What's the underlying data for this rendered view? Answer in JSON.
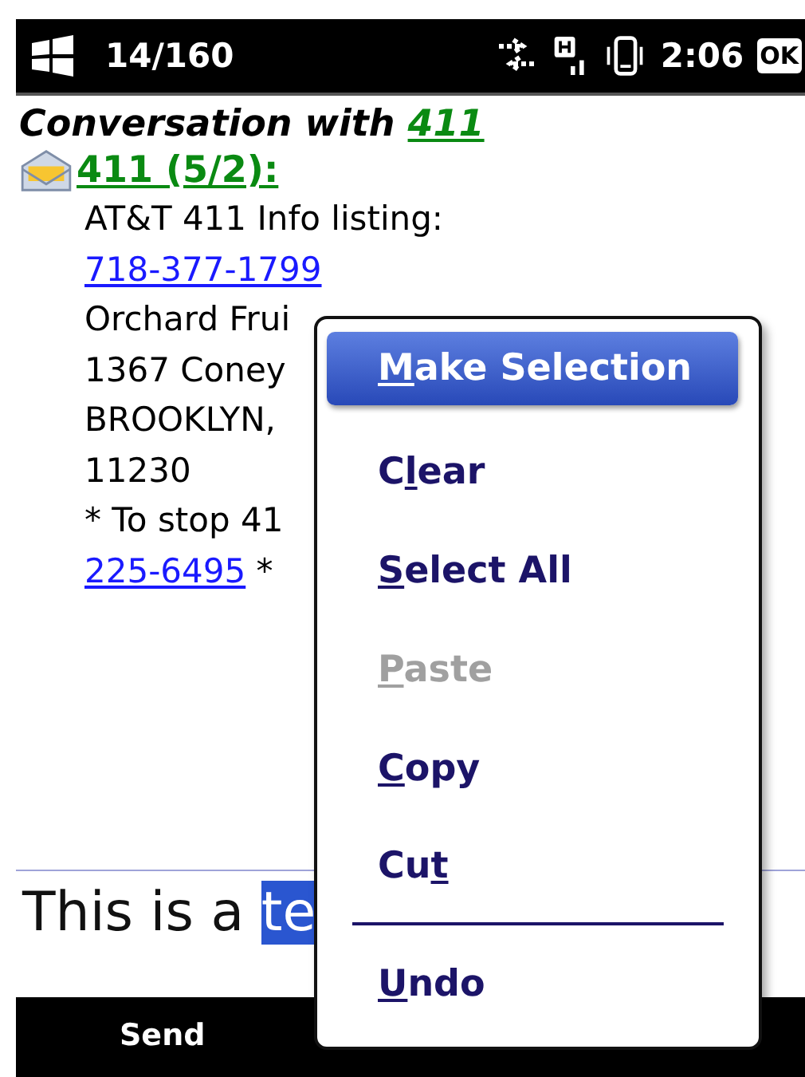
{
  "status_bar": {
    "counter": "14/160",
    "time": "2:06",
    "ok_button": "OK"
  },
  "conversation": {
    "title": "Conversation with ",
    "contact": "411"
  },
  "message": {
    "header": "411 (5/2):",
    "lines": [
      {
        "segments": [
          {
            "text": "AT&T 411 Info listing:",
            "kind": "text"
          }
        ]
      },
      {
        "segments": [
          {
            "text": "718-377-1799",
            "kind": "link"
          }
        ]
      },
      {
        "segments": [
          {
            "text": "Orchard Frui",
            "kind": "text"
          }
        ]
      },
      {
        "segments": [
          {
            "text": "1367 Coney",
            "kind": "text"
          }
        ]
      },
      {
        "segments": [
          {
            "text": "BROOKLYN,",
            "kind": "text"
          }
        ]
      },
      {
        "segments": [
          {
            "text": "11230",
            "kind": "text"
          }
        ]
      },
      {
        "segments": [
          {
            "text": "* To stop 41",
            "kind": "text"
          }
        ]
      },
      {
        "segments": [
          {
            "text": "225-6495",
            "kind": "link"
          },
          {
            "text": " *",
            "kind": "text"
          }
        ]
      }
    ]
  },
  "compose": {
    "value": "This is a ",
    "selected_text": "te"
  },
  "soft_keys": {
    "left": "Send"
  },
  "context_menu": {
    "items": [
      {
        "kind": "item",
        "key": "M",
        "after": "ake Selection",
        "selected": true,
        "disabled": false
      },
      {
        "kind": "item",
        "before": "C",
        "key": "l",
        "after": "ear",
        "selected": false,
        "disabled": false
      },
      {
        "kind": "item",
        "key": "S",
        "after": "elect All",
        "selected": false,
        "disabled": false
      },
      {
        "kind": "item",
        "key": "P",
        "after": "aste",
        "selected": false,
        "disabled": true
      },
      {
        "kind": "item",
        "key": "C",
        "after": "opy",
        "selected": false,
        "disabled": false
      },
      {
        "kind": "item",
        "before": "Cu",
        "key": "t",
        "selected": false,
        "disabled": false
      },
      {
        "kind": "separator"
      },
      {
        "kind": "item",
        "key": "U",
        "after": "ndo",
        "selected": false,
        "disabled": false
      }
    ]
  }
}
